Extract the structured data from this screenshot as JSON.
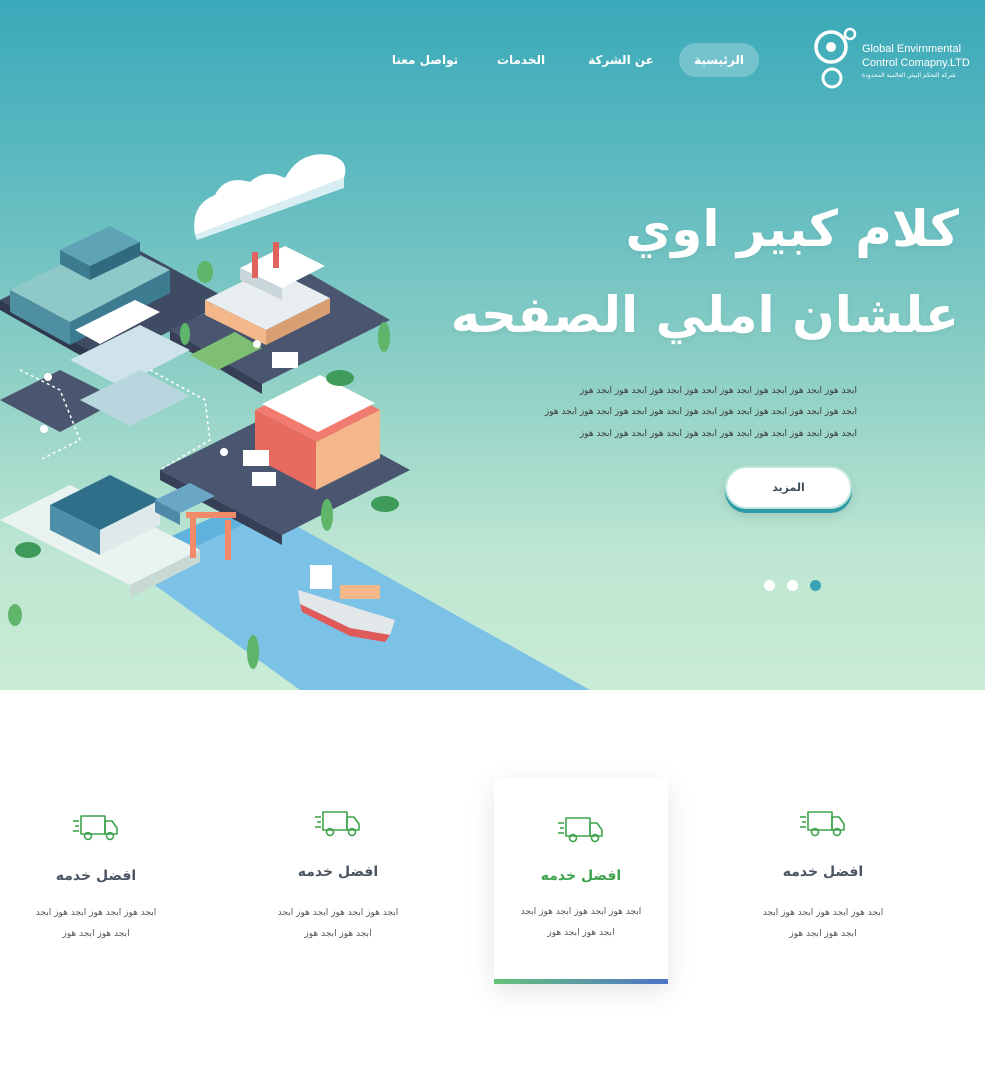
{
  "logo": {
    "line1": "Global Envirnmental",
    "line2": "Control Comapny.LTD",
    "line3": "شركة التحكم البيئي العالمية المحدودة"
  },
  "nav": {
    "items": [
      {
        "label": "الرئيسية",
        "active": true
      },
      {
        "label": "عن الشركة",
        "active": false
      },
      {
        "label": "الخدمات",
        "active": false
      },
      {
        "label": "تواصل معنا",
        "active": false
      }
    ]
  },
  "hero": {
    "headline_line1": "كلام كبير اوي",
    "headline_line2": "علشان املي الصفحه",
    "paragraph_lines": [
      "ابجد هوز ابجد هوز ابجد هوز ابجد هوز ابجد هوز ابجد هوز ابجد هوز ابجد هوز",
      "ابجد هوز ابجد هوز ابجد هوز ابجد هوز ابجد هوز ابجد هوز ابجد هوز ابجد هوز ابجد هوز",
      "ابجد هوز ابجد هوز ابجد هوز ابجد هوز ابجد هوز ابجد هوز ابجد هوز ابجد هوز"
    ],
    "more_button": "المزيد",
    "slider": {
      "count": 3,
      "active_index": 2
    }
  },
  "services": [
    {
      "title": "افضل خدمه",
      "desc_line1": "ابجد هوز ابجد هوز ابجد هوز ابجد",
      "desc_line2": "ابجد هوز ابجد هوز",
      "icon": "delivery-truck-icon",
      "featured": false
    },
    {
      "title": "افضل خدمه",
      "desc_line1": "ابجد هوز ابجد هوز ابجد هوز ابجد",
      "desc_line2": "ابجد هوز ابجد هوز",
      "icon": "delivery-truck-icon",
      "featured": true
    },
    {
      "title": "افضل خدمه",
      "desc_line1": "ابجد هوز ابجد هوز ابجد هوز ابجد",
      "desc_line2": "ابجد هوز ابجد هوز",
      "icon": "delivery-truck-icon",
      "featured": false
    },
    {
      "title": "افضل خدمه",
      "desc_line1": "ابجد هوز ابجد هوز ابجد هوز ابجد",
      "desc_line2": "ابجد هوز ابجد هوز",
      "icon": "delivery-truck-icon",
      "featured": false
    }
  ],
  "colors": {
    "hero_top": "#3aa9b9",
    "hero_bottom": "#c9ecd6",
    "accent_green": "#3fa34d",
    "accent_blue": "#4e73c8",
    "slider_active": "#3aa3b5"
  }
}
